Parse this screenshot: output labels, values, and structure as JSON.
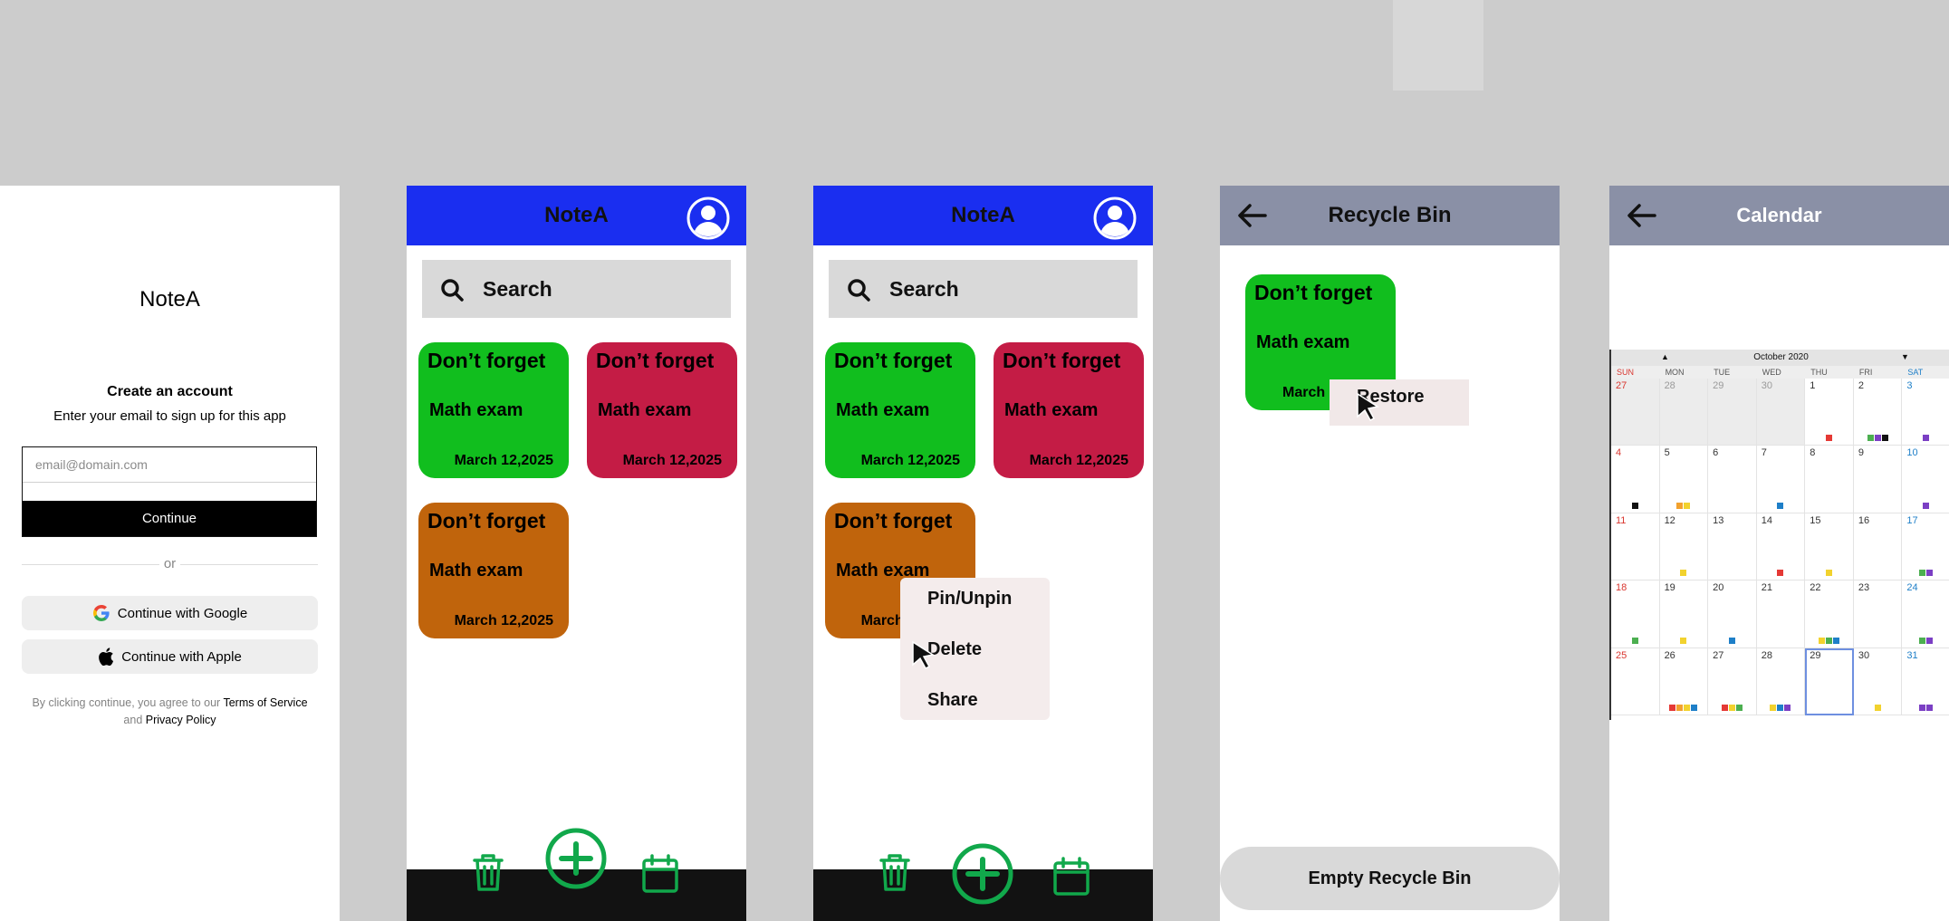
{
  "login": {
    "app_title": "NoteA",
    "heading": "Create an account",
    "subheading": "Enter your email to sign up for this app",
    "email_placeholder": "email@domain.com",
    "continue_label": "Continue",
    "or_label": "or",
    "google_label": "Continue with Google",
    "apple_label": "Continue with Apple",
    "legal_prefix": "By clicking continue, you agree to our",
    "terms_label": "Terms of Service",
    "legal_and": "and",
    "privacy_label": "Privacy Policy"
  },
  "home": {
    "title": "NoteA",
    "search_label": "Search",
    "notes": [
      {
        "title": "Don’t forget",
        "subtitle": "Math exam",
        "date": "March 12,2025",
        "color": "#11be1e"
      },
      {
        "title": "Don’t forget",
        "subtitle": "Math exam",
        "date": "March 12,2025",
        "color": "#c41c45"
      },
      {
        "title": "Don’t forget",
        "subtitle": "Math exam",
        "date": "March 12,2025",
        "color": "#c0640c"
      }
    ]
  },
  "context_menu": {
    "pin_label": "Pin/Unpin",
    "delete_label": "Delete",
    "share_label": "Share"
  },
  "recycle": {
    "title": "Recycle Bin",
    "note_title": "Don’t forget",
    "note_subtitle": "Math exam",
    "note_date_partial": "March 1",
    "restore_label": "Restore",
    "empty_label": "Empty Recycle Bin"
  },
  "calendar": {
    "title": "Calendar",
    "month_label": "October 2020",
    "up_arrow": "▲",
    "down_arrow": "▼",
    "days_of_week": [
      "SUN",
      "MON",
      "TUE",
      "WED",
      "THU",
      "FRI",
      "SAT"
    ],
    "selected_day": 29,
    "weeks": [
      [
        {
          "d": "27",
          "out": true,
          "dots": []
        },
        {
          "d": "28",
          "out": true,
          "dots": []
        },
        {
          "d": "29",
          "out": true,
          "dots": []
        },
        {
          "d": "30",
          "out": true,
          "dots": []
        },
        {
          "d": "1",
          "dots": [
            "#e53935"
          ]
        },
        {
          "d": "2",
          "dots": [
            "#4caf50",
            "#7b3fc4",
            "#111111"
          ]
        },
        {
          "d": "3",
          "dots": [
            "#7b3fc4"
          ]
        }
      ],
      [
        {
          "d": "4",
          "dots": [
            "#111111"
          ]
        },
        {
          "d": "5",
          "dots": [
            "#f2a12e",
            "#f2d22e"
          ]
        },
        {
          "d": "6",
          "dots": []
        },
        {
          "d": "7",
          "dots": [
            "#1e7fc8"
          ]
        },
        {
          "d": "8",
          "dots": []
        },
        {
          "d": "9",
          "dots": []
        },
        {
          "d": "10",
          "dots": [
            "#7b3fc4"
          ]
        }
      ],
      [
        {
          "d": "11",
          "dots": []
        },
        {
          "d": "12",
          "dots": [
            "#f2d22e"
          ]
        },
        {
          "d": "13",
          "dots": []
        },
        {
          "d": "14",
          "dots": [
            "#e53935"
          ]
        },
        {
          "d": "15",
          "dots": [
            "#f2d22e"
          ]
        },
        {
          "d": "16",
          "dots": []
        },
        {
          "d": "17",
          "dots": [
            "#4caf50",
            "#7b3fc4"
          ]
        }
      ],
      [
        {
          "d": "18",
          "dots": [
            "#4caf50"
          ]
        },
        {
          "d": "19",
          "dots": [
            "#f2d22e"
          ]
        },
        {
          "d": "20",
          "dots": [
            "#1e7fc8"
          ]
        },
        {
          "d": "21",
          "dots": []
        },
        {
          "d": "22",
          "dots": [
            "#f2d22e",
            "#4caf50",
            "#1e7fc8"
          ]
        },
        {
          "d": "23",
          "dots": []
        },
        {
          "d": "24",
          "dots": [
            "#4caf50",
            "#7b3fc4"
          ]
        }
      ],
      [
        {
          "d": "25",
          "dots": []
        },
        {
          "d": "26",
          "dots": [
            "#e53935",
            "#f2a12e",
            "#f2d22e",
            "#1e7fc8"
          ]
        },
        {
          "d": "27",
          "dots": [
            "#e53935",
            "#f2d22e",
            "#4caf50"
          ]
        },
        {
          "d": "28",
          "dots": [
            "#f2d22e",
            "#1e7fc8",
            "#7b3fc4"
          ]
        },
        {
          "d": "29",
          "dots": []
        },
        {
          "d": "30",
          "dots": [
            "#f2d22e"
          ]
        },
        {
          "d": "31",
          "dots": [
            "#7b3fc4",
            "#7b3fc4"
          ]
        }
      ]
    ]
  }
}
